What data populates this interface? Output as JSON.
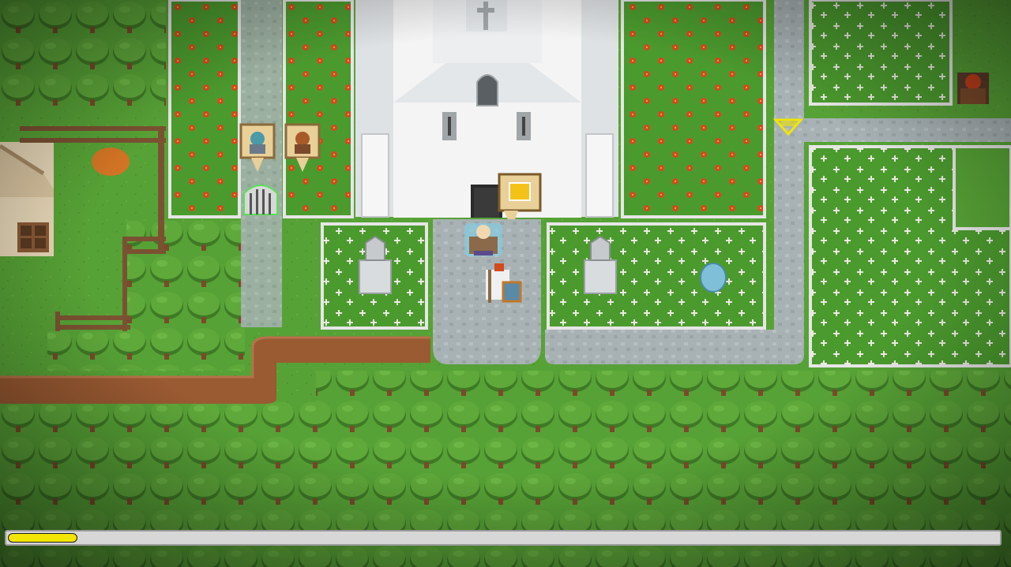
{
  "game": {
    "location": "churchyard",
    "colors": {
      "grass": "#57a236",
      "grass_dark": "#3f7d24",
      "bush": "#5fa83a",
      "bush_shadow": "#3e7a26",
      "path_stone": "#a8b2b4",
      "dirt": "#9a5a32",
      "church_wall": "#f4f4f4",
      "church_shadow": "#cfd3d6",
      "flower_red": "#d24a1f",
      "flower_white": "#ecebe2",
      "fence": "#7a5232",
      "highlight": "#f2e600"
    },
    "icons": {
      "church": "church-building-icon",
      "gate": "iron-gate-icon",
      "player": "knight-player-icon",
      "priest": "priest-npc-icon",
      "quest_marker": "gold-speech-bubble-icon",
      "waypoint": "yellow-gem-marker-icon",
      "tombstone": "tombstone-icon",
      "portrait": "npc-portrait-sign-icon"
    }
  },
  "hud": {
    "progress": 0.07,
    "progress_label": ""
  }
}
